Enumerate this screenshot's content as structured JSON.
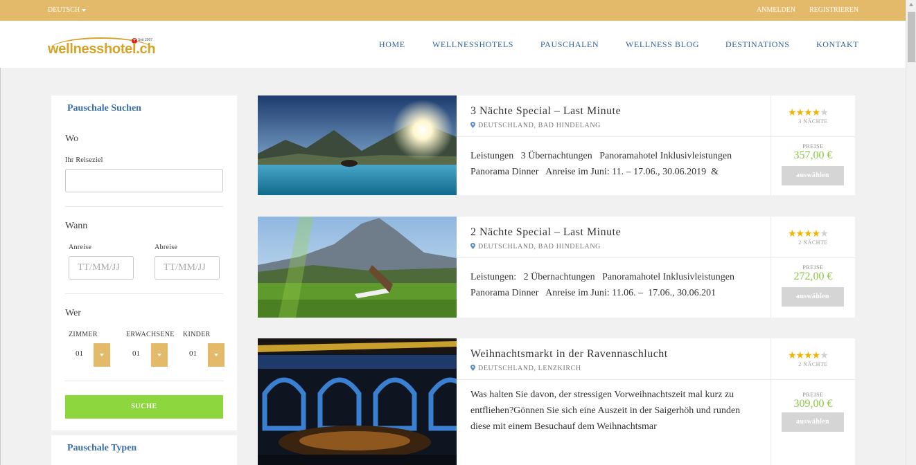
{
  "topbar": {
    "language": "DEUTSCH",
    "login": "ANMELDEN",
    "register": "REGISTRIEREN"
  },
  "logo": {
    "text": "wellnesshotel.ch",
    "since": "Seit 2007"
  },
  "nav": [
    "HOME",
    "WELLNESSHOTELS",
    "PAUSCHALEN",
    "WELLNESS BLOG",
    "DESTINATIONS",
    "KONTAKT"
  ],
  "sidebar": {
    "title": "Pauschale Suchen",
    "where": {
      "label": "Wo",
      "field_label": "Ihr Reiseziel",
      "value": ""
    },
    "when": {
      "label": "Wann",
      "arrival_label": "Anreise",
      "arrival_placeholder": "TT/MM/JJ",
      "departure_label": "Abreise",
      "departure_placeholder": "TT/MM/JJ"
    },
    "who": {
      "label": "Wer",
      "rooms_label": "ZIMMER",
      "rooms": "01",
      "adults_label": "ERWACHSENE",
      "adults": "01",
      "children_label": "KINDER",
      "children": "01"
    },
    "search_label": "SUCHE",
    "types_title": "Pauschale Typen"
  },
  "offers": [
    {
      "title": "3 Nächte Special – Last Minute",
      "location": "DEUTSCHLAND, BAD HINDELANG",
      "description": [
        "Leistungen   3 Übernachtungen   Panoramahotel Inklusivleistungen",
        "Panorama Dinner   Anreise im Juni: 11. – 17.06., 30.06.2019  &"
      ],
      "stars": 4,
      "nights": "3 NÄCHTE",
      "price_label": "PREISE",
      "price": "357,00 €",
      "select_label": "auswählen"
    },
    {
      "title": "2 Nächte Special – Last Minute",
      "location": "DEUTSCHLAND, BAD HINDELANG",
      "description": [
        "Leistungen:   2 Übernachtungen   Panoramahotel Inklusivleistungen",
        "Panorama Dinner   Anreise im Juni: 11.06. –  17.06., 30.06.201"
      ],
      "stars": 4,
      "nights": "2 NÄCHTE",
      "price_label": "PREISE",
      "price": "272,00 €",
      "select_label": "auswählen"
    },
    {
      "title": "Weihnachtsmarkt in der Ravennaschlucht",
      "location": "DEUTSCHLAND, LENZKIRCH",
      "description": [
        "Was halten Sie davon, der stressigen Vorweihnachtszeit mal kurz zu",
        "entfliehen?Gönnen Sie sich eine Auszeit in der Saigerhöh und runden",
        "diese mit einem Besuchauf dem Weihnachtsmar"
      ],
      "stars": 4,
      "nights": "2 NÄCHTE",
      "price_label": "PREISE",
      "price": "309,00 €",
      "select_label": "auswählen"
    }
  ],
  "colors": {
    "topbar": "#e3b96a",
    "nav": "#2f63a1",
    "search_button": "#8ed63d",
    "price": "#8cc63f",
    "star": "#f0b400"
  }
}
